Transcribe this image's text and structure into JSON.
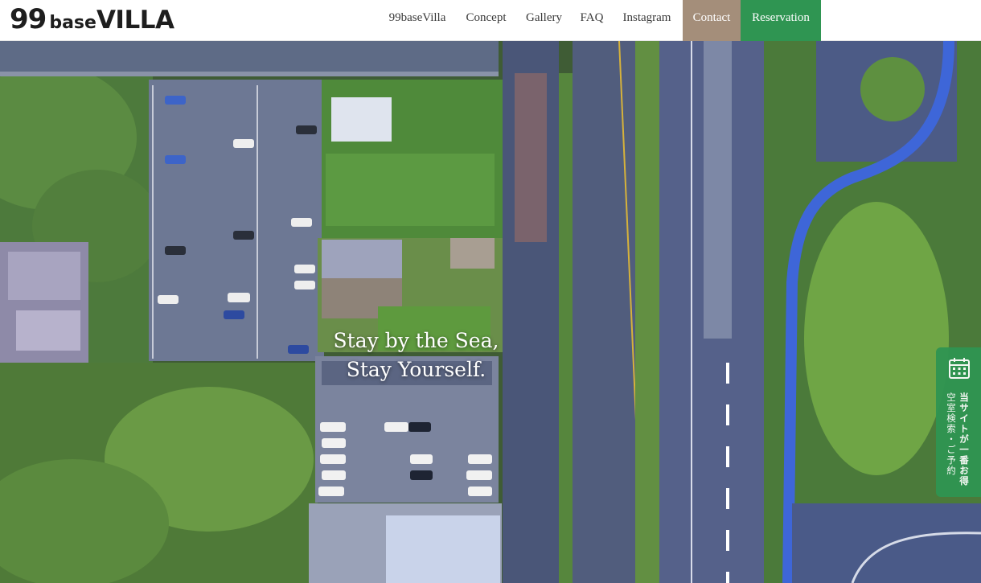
{
  "header": {
    "logo": {
      "num": "99",
      "base": "base",
      "villa": "VILLA"
    },
    "nav": [
      {
        "label": "99baseVilla"
      },
      {
        "label": "Concept"
      },
      {
        "label": "Gallery"
      },
      {
        "label": "FAQ"
      },
      {
        "label": "Instagram"
      }
    ],
    "contact_label": "Contact",
    "reservation_label": "Reservation"
  },
  "hero": {
    "tagline_line1": "Stay by the Sea,",
    "tagline_line2": "Stay Yourself."
  },
  "side_tab": {
    "icon": "calendar-icon",
    "line1": "当サイトが一番お得",
    "line2": "空室検索・ご予約"
  },
  "colors": {
    "contact_bg": "#a48e7a",
    "reservation_bg": "#2f9552",
    "side_tab_bg": "#2f9552"
  }
}
